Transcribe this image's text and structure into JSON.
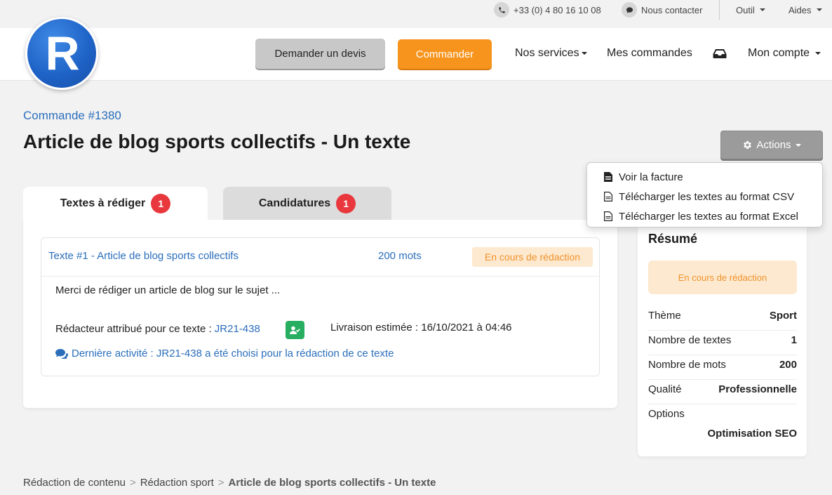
{
  "topbar": {
    "phone": "+33 (0) 4 80 16 10 08",
    "contact": "Nous contacter",
    "tools": "Outil",
    "help": "Aides"
  },
  "header": {
    "logo_letter": "R",
    "quote_button": "Demander un devis",
    "order_button": "Commander",
    "nav": {
      "services": "Nos services",
      "orders": "Mes commandes",
      "account": "Mon compte"
    }
  },
  "page": {
    "order_link": "Commande #1380",
    "title": "Article de blog sports collectifs - Un texte",
    "actions_button": "Actions"
  },
  "actions_menu": [
    {
      "label": "Voir la facture",
      "icon": "file-solid-icon"
    },
    {
      "label": "Télécharger les textes au format CSV",
      "icon": "file-outline-icon"
    },
    {
      "label": "Télécharger les textes au format Excel",
      "icon": "file-outline-icon"
    }
  ],
  "tabs": [
    {
      "label": "Textes à rédiger",
      "count": "1"
    },
    {
      "label": "Candidatures",
      "count": "1"
    }
  ],
  "text_card": {
    "title": "Texte #1 - Article de blog sports collectifs",
    "words": "200 mots",
    "status": "En cours de rédaction",
    "brief": "Merci de rédiger un article de blog sur le sujet ...",
    "writer_label": "Rédacteur attribué pour ce texte : ",
    "writer_id": "JR21-438",
    "delivery": "Livraison estimée : 16/10/2021 à 04:46",
    "activity": "Dernière activité : JR21-438 a été choisi pour la rédaction de ce texte"
  },
  "summary": {
    "title": "Résumé",
    "status": "En cours de rédaction",
    "rows": [
      {
        "label": "Thème",
        "value": "Sport"
      },
      {
        "label": "Nombre de textes",
        "value": "1"
      },
      {
        "label": "Nombre de mots",
        "value": "200"
      },
      {
        "label": "Qualité",
        "value": "Professionnelle"
      },
      {
        "label": "Options",
        "value": "Optimisation SEO"
      }
    ]
  },
  "breadcrumb": [
    "Rédaction de contenu",
    "Rédaction sport",
    "Article de blog sports collectifs - Un texte"
  ],
  "colors": {
    "accent_orange": "#f7941d",
    "link_blue": "#2a6ebb",
    "badge_red": "#e8383d",
    "status_bg": "#fde9cf",
    "status_text": "#f0922b",
    "writer_green": "#27ae60"
  }
}
